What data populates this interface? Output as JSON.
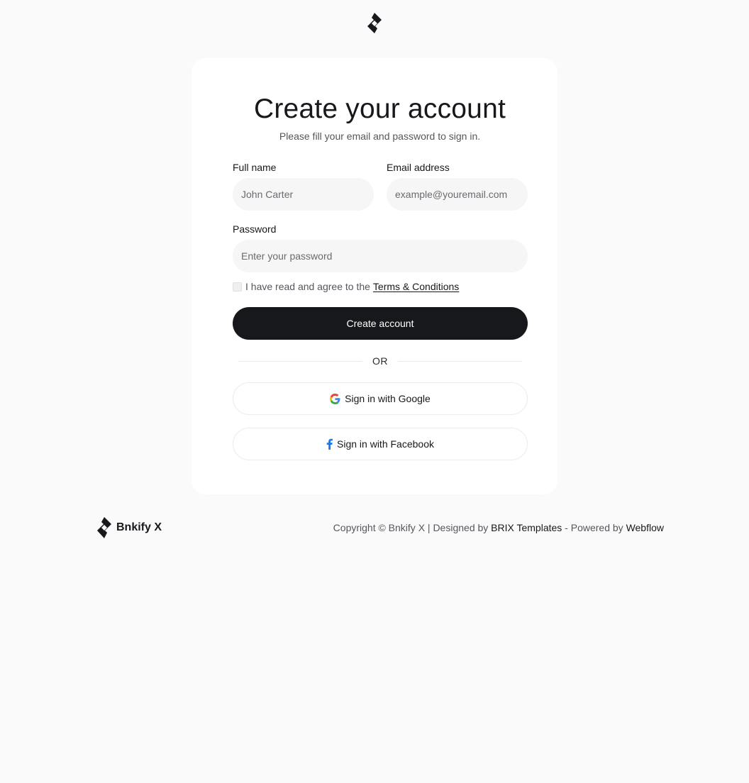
{
  "brand": {
    "name": "Bnkify X",
    "logo_icon": "diamond-logo-icon"
  },
  "form": {
    "title": "Create your account",
    "subtitle": "Please fill your email and password to sign in.",
    "full_name": {
      "label": "Full name",
      "placeholder": "John Carter",
      "value": ""
    },
    "email": {
      "label": "Email address",
      "placeholder": "example@youremail.com",
      "value": ""
    },
    "password": {
      "label": "Password",
      "placeholder": "Enter your password",
      "value": ""
    },
    "terms": {
      "text": "I have read and agree to the",
      "link_label": "Terms & Conditions",
      "checked": false
    },
    "submit_label": "Create account",
    "divider_label": "OR",
    "google_label": "Sign in with Google",
    "google_icon": "google-icon",
    "facebook_label": "Sign in with Facebook",
    "facebook_icon": "facebook-icon"
  },
  "footer": {
    "copyright": "Copyright © Bnkify X | Designed by",
    "designer_link": "BRIX Templates",
    "powered_by": " - Powered by ",
    "platform_link": "Webflow"
  },
  "colors": {
    "background": "#fafafa",
    "card": "#ffffff",
    "primary": "#17181c",
    "input_bg": "#f6f6f6",
    "facebook_blue": "#1877f2"
  }
}
